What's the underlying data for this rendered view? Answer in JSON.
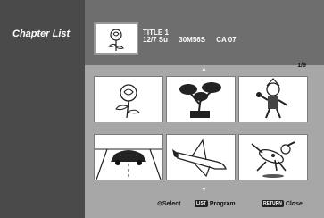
{
  "sidebar": {
    "title": "Chapter List"
  },
  "current_title": {
    "name": "TITLE 1",
    "date": "12/7 Su",
    "duration": "30M56S",
    "channel": "CA 07",
    "thumbnail_icon": "rose-icon"
  },
  "page_indicator": "1/9",
  "chapters": [
    {
      "icon": "rose-icon"
    },
    {
      "icon": "bonsai-tree-icon"
    },
    {
      "icon": "clown-icon"
    },
    {
      "icon": "car-road-icon"
    },
    {
      "icon": "space-shuttle-icon"
    },
    {
      "icon": "running-dog-icon"
    }
  ],
  "footer": {
    "select_label": "Select",
    "list_key": "LIST",
    "program_label": "Program",
    "return_key": "RETURN",
    "close_label": "Close"
  }
}
